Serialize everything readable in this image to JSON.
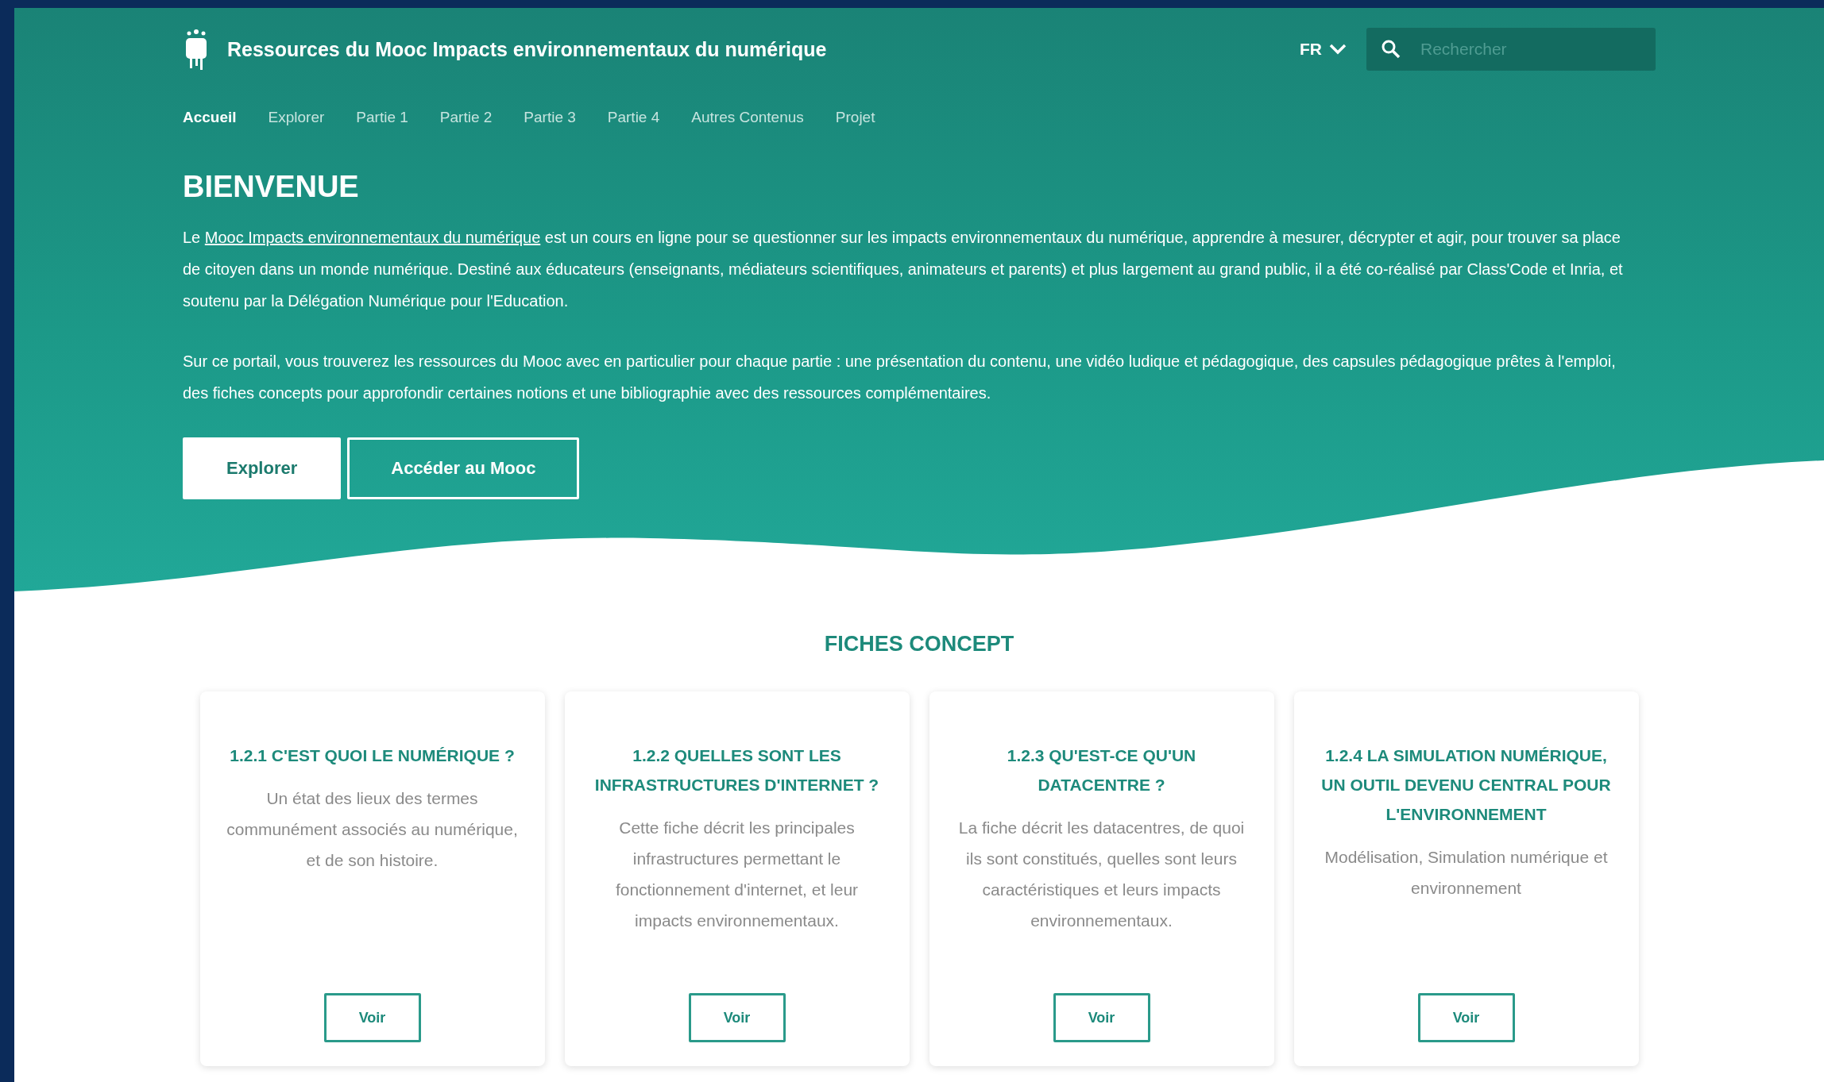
{
  "site_title": "Ressources du Mooc Impacts environnementaux du numérique",
  "language": {
    "label": "FR"
  },
  "search": {
    "placeholder": "Rechercher"
  },
  "nav": [
    {
      "label": "Accueil",
      "selected": true
    },
    {
      "label": "Explorer",
      "selected": false
    },
    {
      "label": "Partie 1",
      "selected": false
    },
    {
      "label": "Partie 2",
      "selected": false
    },
    {
      "label": "Partie 3",
      "selected": false
    },
    {
      "label": "Partie 4",
      "selected": false
    },
    {
      "label": "Autres Contenus",
      "selected": false
    },
    {
      "label": "Projet",
      "selected": false
    }
  ],
  "hero": {
    "title": "BIENVENUE",
    "intro": {
      "before": "Le",
      "link": "Mooc Impacts environnementaux du numérique",
      "after": "est un cours en ligne pour se questionner sur les impacts environnementaux du numérique, apprendre à mesurer, décrypter et agir, pour trouver sa place de citoyen dans un monde numérique. Destiné aux éducateurs (enseignants, médiateurs scientifiques, animateurs et parents) et plus largement au grand public, il a été co-réalisé par Class'Code et Inria, et soutenu par la Délégation Numérique pour l'Education."
    },
    "paragraph": "Sur ce portail, vous trouverez les ressources du Mooc avec en particulier pour chaque partie : une présentation du contenu, une vidéo ludique et pédagogique, des capsules pédagogique prêtes à l'emploi, des fiches concepts pour approfondir certaines notions et une bibliographie avec des ressources complémentaires.",
    "buttons": [
      {
        "label": "Explorer",
        "kind": "solid"
      },
      {
        "label": "Accéder au Mooc",
        "kind": "outline"
      }
    ]
  },
  "section": {
    "title": "FICHES CONCEPT",
    "cards": [
      {
        "title": "1.2.1 C'EST QUOI LE NUMÉRIQUE ?",
        "description": "Un état des lieux des termes communément associés au numérique, et de son histoire.",
        "button": "Voir"
      },
      {
        "title": "1.2.2 QUELLES SONT LES INFRASTRUCTURES D'INTERNET ?",
        "description": "Cette fiche décrit les principales infrastructures permettant le fonctionnement d'internet, et leur impacts environnementaux.",
        "button": "Voir"
      },
      {
        "title": "1.2.3 QU'EST-CE QU'UN DATACENTRE ?",
        "description": "La fiche décrit les datacentres, de quoi ils sont constitués, quelles sont leurs caractéristiques et leurs impacts environnementaux.",
        "button": "Voir"
      },
      {
        "title": "1.2.4 LA SIMULATION NUMÉRIQUE, UN OUTIL DEVENU CENTRAL POUR L'ENVIRONNEMENT",
        "description": "Modélisation, Simulation numérique et environnement",
        "button": "Voir"
      }
    ]
  }
}
